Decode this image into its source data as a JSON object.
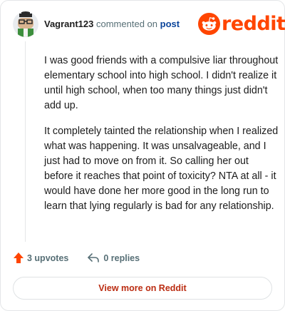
{
  "comment": {
    "username": "Vagrant123",
    "commented_text": "commented on",
    "post_link": "post",
    "paragraphs": [
      "I was good friends with a compulsive liar throughout elementary school into high school. I didn't realize it until high school, when too many things just didn't add up.",
      "It completely tainted the relationship when I realized what was happening. It was unsalvageable, and I just had to move on from it. So calling her out before it reaches that point of toxicity? NTA at all - it would have done her more good in the long run to learn that lying regularly is bad for any relationship."
    ],
    "upvotes": "3 upvotes",
    "replies": "0 replies"
  },
  "brand": {
    "wordmark": "reddit",
    "color": "#ff4500"
  },
  "cta": {
    "label": "View more on Reddit"
  },
  "icons": {
    "avatar": "snoo-avatar-icon",
    "logo": "reddit-logo-icon",
    "upvote": "upvote-arrow-icon",
    "reply": "reply-arrow-icon"
  }
}
